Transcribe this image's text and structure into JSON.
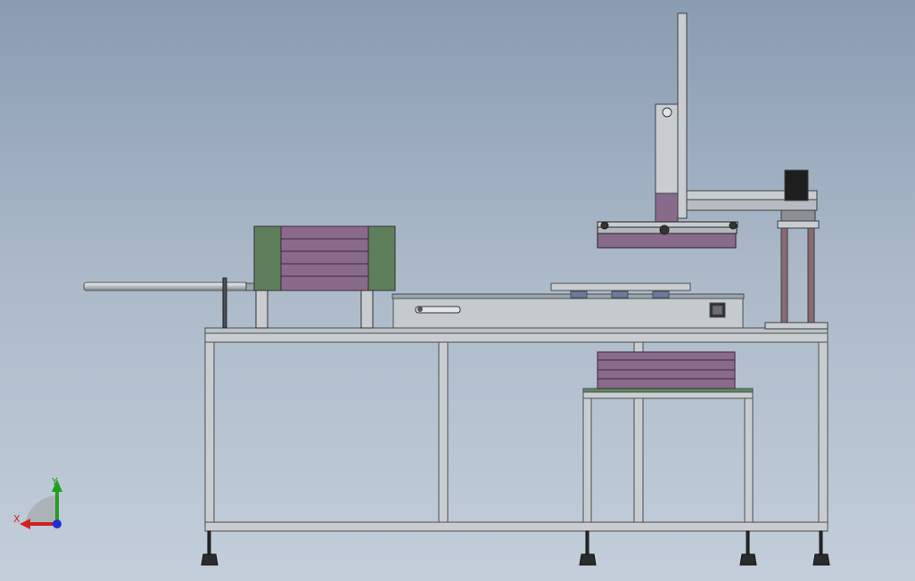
{
  "scene": {
    "description_visible_text": "none",
    "view": "front",
    "colors": {
      "background_top": "#8a9cb1",
      "background_bottom": "#c4cedb",
      "frame": "#c9cdcf",
      "frame_edge": "#4a4f55",
      "panel_purple": "#8a6a8a",
      "panel_green": "#5e7f5c",
      "rod_silver": "#d8dcdf",
      "base_feet": "#2b2b2b"
    }
  },
  "triad": {
    "x_label": "X",
    "y_label": "Y",
    "x_color": "#d02020",
    "y_color": "#20a020",
    "z_color": "#2030d0"
  }
}
